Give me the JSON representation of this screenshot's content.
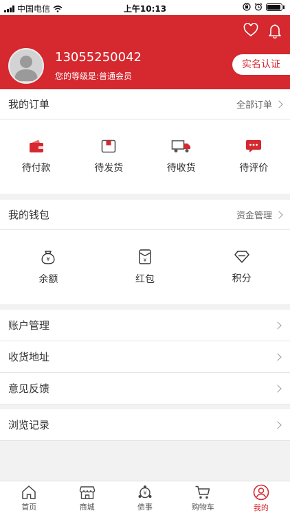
{
  "status_bar": {
    "carrier": "中国电信",
    "time": "上午10:13"
  },
  "header": {
    "phone": "13055250042",
    "level": "您的等级是:普通会员",
    "verify_label": "实名认证",
    "accent": "#d5282f"
  },
  "orders": {
    "title": "我的订单",
    "all_link": "全部订单",
    "items": [
      {
        "label": "待付款",
        "icon": "wallet-icon"
      },
      {
        "label": "待发货",
        "icon": "package-icon"
      },
      {
        "label": "待收货",
        "icon": "truck-icon"
      },
      {
        "label": "待评价",
        "icon": "chat-icon"
      }
    ]
  },
  "wallet": {
    "title": "我的钱包",
    "manage_link": "资金管理",
    "items": [
      {
        "label": "余额",
        "icon": "money-bag-icon"
      },
      {
        "label": "红包",
        "icon": "red-packet-icon"
      },
      {
        "label": "积分",
        "icon": "diamond-icon"
      }
    ]
  },
  "menu": {
    "account": "账户管理",
    "address": "收货地址",
    "feedback": "意见反馈",
    "history": "浏览记录"
  },
  "tabbar": {
    "items": [
      {
        "label": "首页",
        "icon": "home-icon"
      },
      {
        "label": "商城",
        "icon": "shop-icon"
      },
      {
        "label": "债事",
        "icon": "debt-icon"
      },
      {
        "label": "购物车",
        "icon": "cart-icon"
      },
      {
        "label": "我的",
        "icon": "user-icon",
        "active": true
      }
    ]
  }
}
